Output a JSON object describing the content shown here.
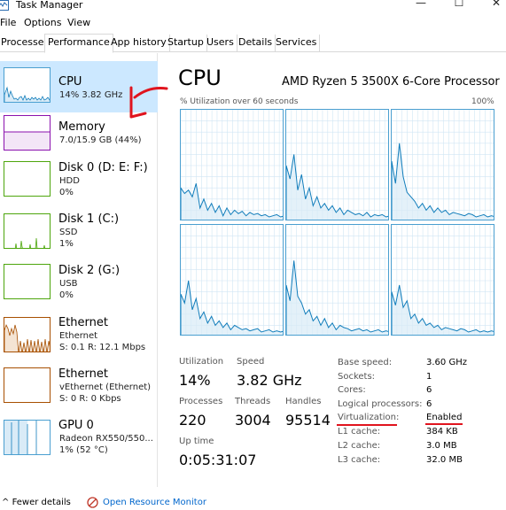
{
  "window": {
    "title": "Task Manager",
    "minimize": "—",
    "maximize": "☐",
    "close": "✕"
  },
  "menu": [
    "File",
    "Options",
    "View"
  ],
  "tabs": [
    "Processes",
    "Performance",
    "App history",
    "Startup",
    "Users",
    "Details",
    "Services"
  ],
  "active_tab": "Performance",
  "sidebar": {
    "items": [
      {
        "name": "CPU",
        "sub1": "14% 3.82 GHz",
        "sub2": "",
        "sub3": "",
        "color": "#117dbb"
      },
      {
        "name": "Memory",
        "sub1": "7.0/15.9 GB (44%)",
        "sub2": "",
        "sub3": "",
        "color": "#8b12ae"
      },
      {
        "name": "Disk 0 (D: E: F:)",
        "sub1": "HDD",
        "sub2": "0%",
        "sub3": "",
        "color": "#4da60c"
      },
      {
        "name": "Disk 1 (C:)",
        "sub1": "SSD",
        "sub2": "1%",
        "sub3": "",
        "color": "#4da60c"
      },
      {
        "name": "Disk 2 (G:)",
        "sub1": "USB",
        "sub2": "0%",
        "sub3": "",
        "color": "#4da60c"
      },
      {
        "name": "Ethernet",
        "sub1": "Ethernet",
        "sub2": "S: 0.1  R: 12.1 Mbps",
        "sub3": "",
        "color": "#a74f01"
      },
      {
        "name": "Ethernet",
        "sub1": "vEthernet (Ethernet)",
        "sub2": "S: 0  R: 0 Kbps",
        "sub3": "",
        "color": "#a74f01"
      },
      {
        "name": "GPU 0",
        "sub1": "Radeon RX550/550...",
        "sub2": "1% (52 °C)",
        "sub3": "",
        "color": "#117dbb"
      }
    ]
  },
  "main": {
    "title": "CPU",
    "processor": "AMD Ryzen 5 3500X 6-Core Processor",
    "util_label": "% Utilization over 60 seconds",
    "util_max": "100%",
    "stats": {
      "utilization_label": "Utilization",
      "utilization": "14%",
      "speed_label": "Speed",
      "speed": "3.82 GHz",
      "processes_label": "Processes",
      "processes": "220",
      "threads_label": "Threads",
      "threads": "3004",
      "handles_label": "Handles",
      "handles": "95514",
      "uptime_label": "Up time",
      "uptime": "0:05:31:07"
    },
    "details": [
      {
        "key": "Base speed:",
        "value": "3.60 GHz"
      },
      {
        "key": "Sockets:",
        "value": "1"
      },
      {
        "key": "Cores:",
        "value": "6"
      },
      {
        "key": "Logical processors:",
        "value": "6"
      },
      {
        "key": "Virtualization:",
        "value": "Enabled"
      },
      {
        "key": "L1 cache:",
        "value": "384 KB"
      },
      {
        "key": "L2 cache:",
        "value": "3.0 MB"
      },
      {
        "key": "L3 cache:",
        "value": "32.0 MB"
      }
    ]
  },
  "footer": {
    "fewer_details": "Fewer details",
    "resource_monitor": "Open Resource Monitor"
  },
  "colors": {
    "cpu_line": "#117dbb",
    "graph_fill": "#d9ebf7",
    "annotation": "#e0141e"
  }
}
